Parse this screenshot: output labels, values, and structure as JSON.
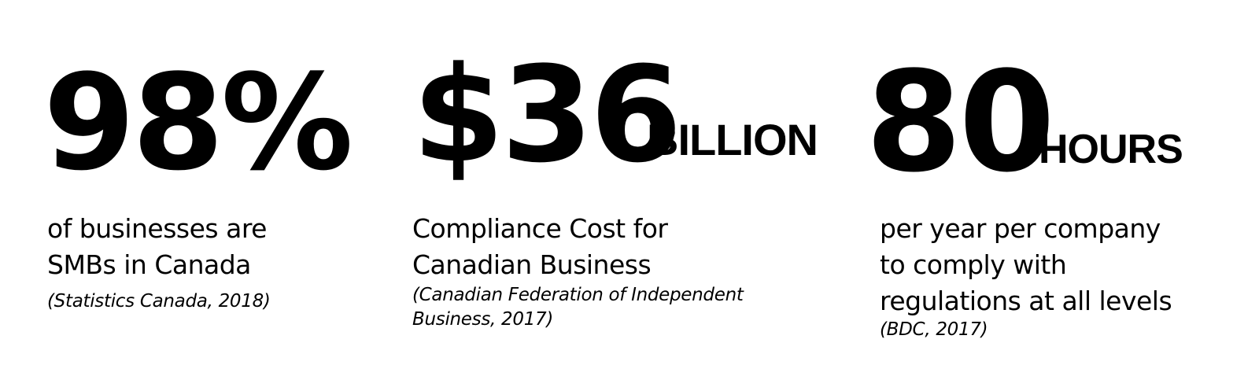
{
  "stats": [
    {
      "figure": "98%",
      "unit": "",
      "description_lines": [
        "of businesses are",
        "SMBs in Canada"
      ],
      "source_lines": [
        "(Statistics Canada, 2018)"
      ]
    },
    {
      "figure": "$36",
      "unit": "BILLION",
      "description_lines": [
        "Compliance Cost for",
        "Canadian Business"
      ],
      "source_lines": [
        "(Canadian Federation of Independent",
        "Business, 2017)"
      ]
    },
    {
      "figure": "80",
      "unit": "HOURS",
      "description_lines": [
        "per year per company",
        "to comply with",
        "regulations at all levels"
      ],
      "source_lines": [
        "(BDC, 2017)"
      ]
    }
  ]
}
